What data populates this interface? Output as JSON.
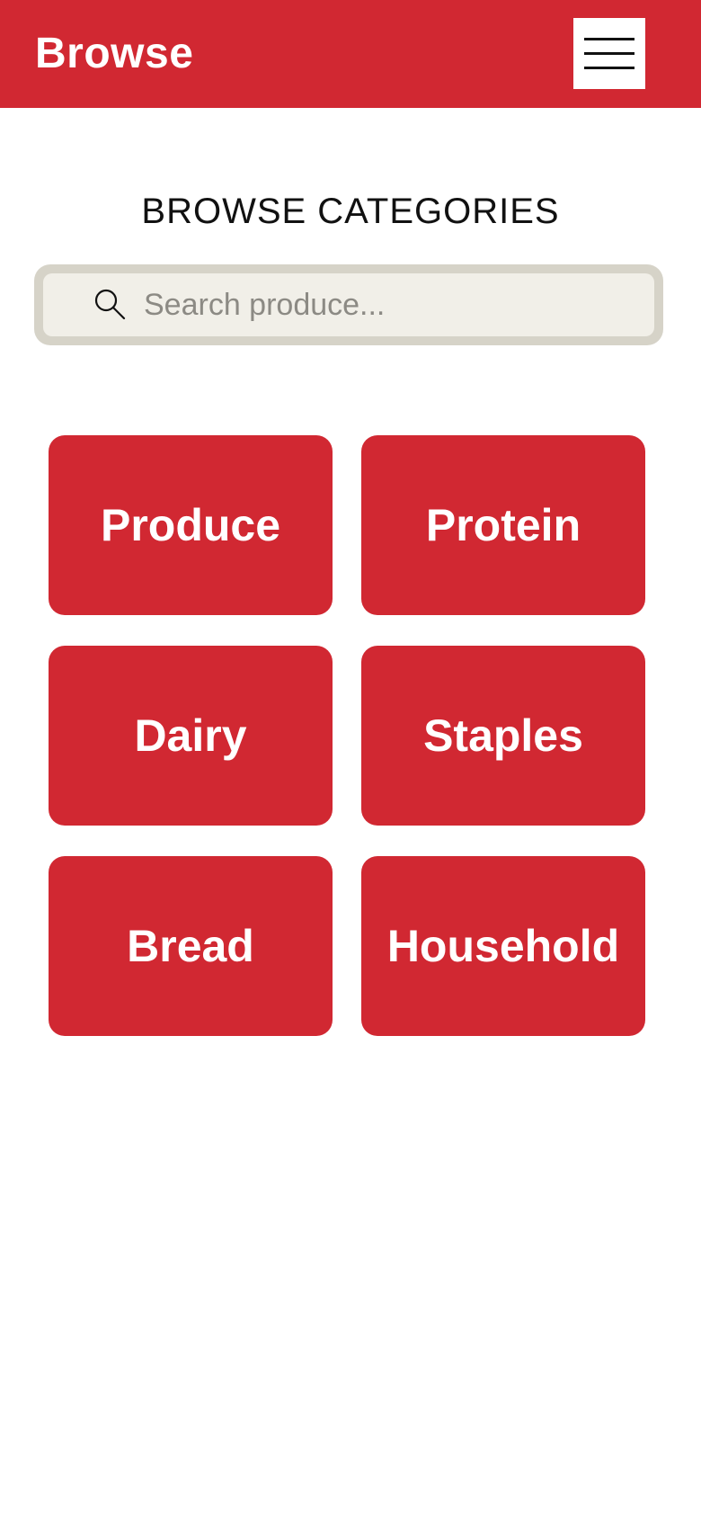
{
  "header": {
    "title": "Browse",
    "menu_icon": "hamburger-menu-icon"
  },
  "main": {
    "heading": "BROWSE CATEGORIES",
    "search": {
      "placeholder": "Search produce...",
      "value": "",
      "icon": "search-icon"
    },
    "categories": [
      {
        "label": "Produce"
      },
      {
        "label": "Protein"
      },
      {
        "label": "Dairy"
      },
      {
        "label": "Staples"
      },
      {
        "label": "Bread"
      },
      {
        "label": "Household"
      }
    ]
  },
  "colors": {
    "brand_red": "#d12832",
    "search_border": "#d6d3c8",
    "search_fill": "#f1efe8",
    "text_dark": "#111111",
    "placeholder_gray": "#8c8a84"
  }
}
